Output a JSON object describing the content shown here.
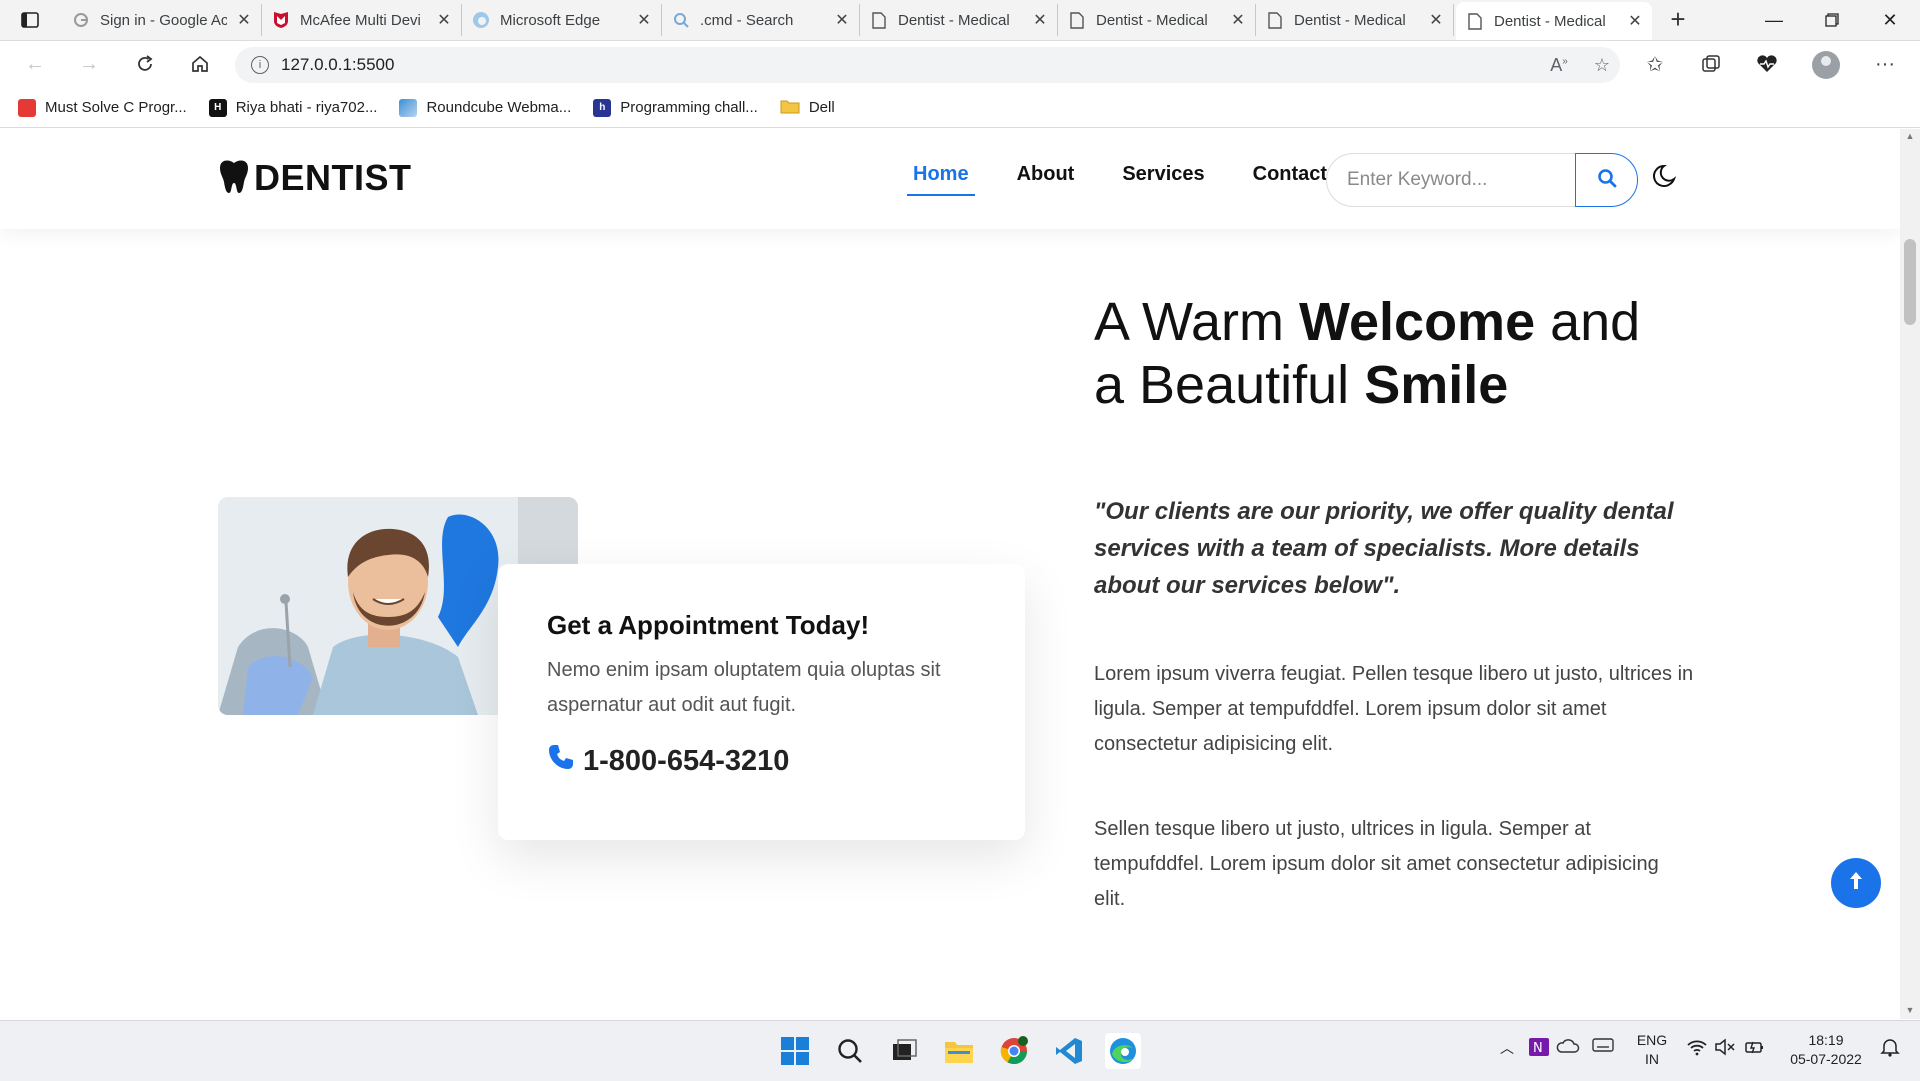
{
  "browser": {
    "tabs": [
      {
        "title": "Sign in - Google Ac",
        "icon": "google-icon",
        "active": false
      },
      {
        "title": "McAfee Multi Devi",
        "icon": "mcafee-icon",
        "active": false
      },
      {
        "title": "Microsoft Edge",
        "icon": "edge-icon",
        "active": false
      },
      {
        "title": ".cmd - Search",
        "icon": "search-icon",
        "active": false
      },
      {
        "title": "Dentist - Medical",
        "icon": "page-icon",
        "active": false
      },
      {
        "title": "Dentist - Medical",
        "icon": "page-icon",
        "active": false
      },
      {
        "title": "Dentist - Medical",
        "icon": "page-icon",
        "active": false
      },
      {
        "title": "Dentist - Medical",
        "icon": "page-icon",
        "active": true
      }
    ],
    "address": "127.0.0.1:5500",
    "bookmarks": [
      {
        "label": "Must Solve C Progr...",
        "color": "#e53935"
      },
      {
        "label": "Riya bhati - riya702...",
        "color": "#111111"
      },
      {
        "label": "Roundcube Webma...",
        "color": "#3b8fd6"
      },
      {
        "label": "Programming chall...",
        "color": "#283593"
      },
      {
        "label": "Dell",
        "color": "#f4c542"
      }
    ]
  },
  "site": {
    "logo": "DENTIST",
    "nav": [
      "Home",
      "About",
      "Services",
      "Contact"
    ],
    "active_nav": "Home",
    "search_placeholder": "Enter Keyword...",
    "hero": {
      "line1_pre": "A Warm ",
      "line1_bold": "Welcome",
      "line1_post": " and",
      "line2_pre": "a Beautiful ",
      "line2_bold": "Smile"
    },
    "quote": "\"Our clients are our priority, we offer quality dental services with a team of specialists. More details about our services below\".",
    "paragraphs": [
      "Lorem ipsum viverra feugiat. Pellen tesque libero ut justo, ultrices in ligula. Semper at tempufddfel. Lorem ipsum dolor sit amet consectetur adipisicing elit.",
      "Sellen tesque libero ut justo, ultrices in ligula. Semper at tempufddfel. Lorem ipsum dolor sit amet consectetur adipisicing elit."
    ],
    "appointment": {
      "title": "Get a Appointment Today!",
      "text": "Nemo enim ipsam oluptatem quia oluptas sit aspernatur aut odit aut fugit.",
      "phone": "1-800-654-3210"
    },
    "accent_color": "#1a73e8"
  },
  "taskbar": {
    "lang": "ENG",
    "region": "IN",
    "time": "18:19",
    "date": "05-07-2022"
  }
}
